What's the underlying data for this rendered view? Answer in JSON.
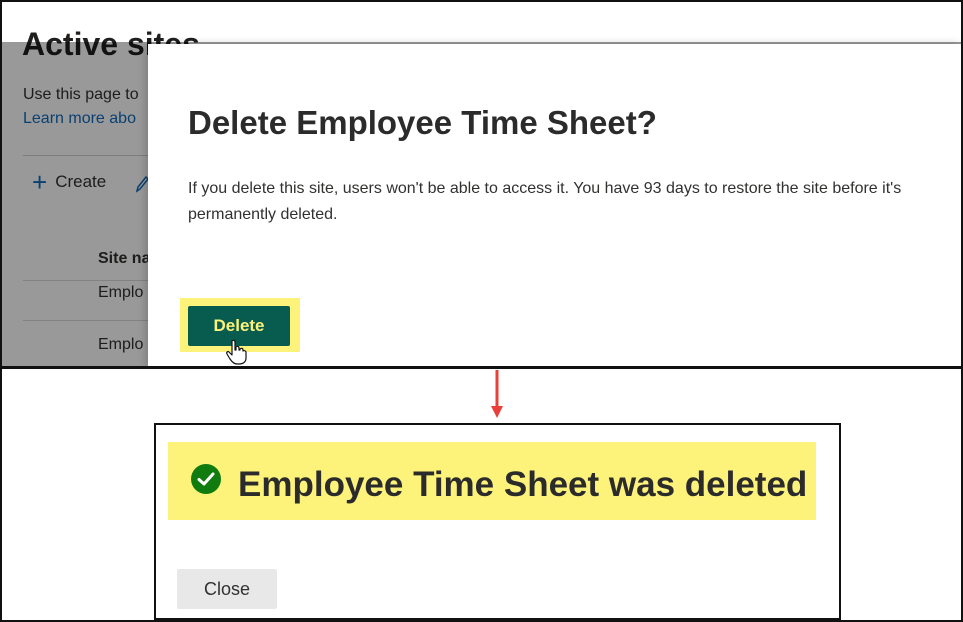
{
  "background_page": {
    "title": "Active sites",
    "description": "Use this page to",
    "learn_more_link": "Learn more abo",
    "create_label": "Create",
    "column_header": "Site na",
    "rows": [
      "Emplo",
      "Emplo"
    ]
  },
  "delete_dialog": {
    "title": "Delete Employee Time Sheet?",
    "body": "If you delete this site, users won't be able to access it. You have 93 days to restore the site before it's permanently deleted.",
    "delete_label": "Delete"
  },
  "confirmation": {
    "message": "Employee Time Sheet was deleted",
    "close_label": "Close"
  },
  "colors": {
    "highlight": "#fdf27a",
    "delete_button": "#075c4f",
    "success_icon": "#107c10",
    "arrow": "#e8413a"
  }
}
